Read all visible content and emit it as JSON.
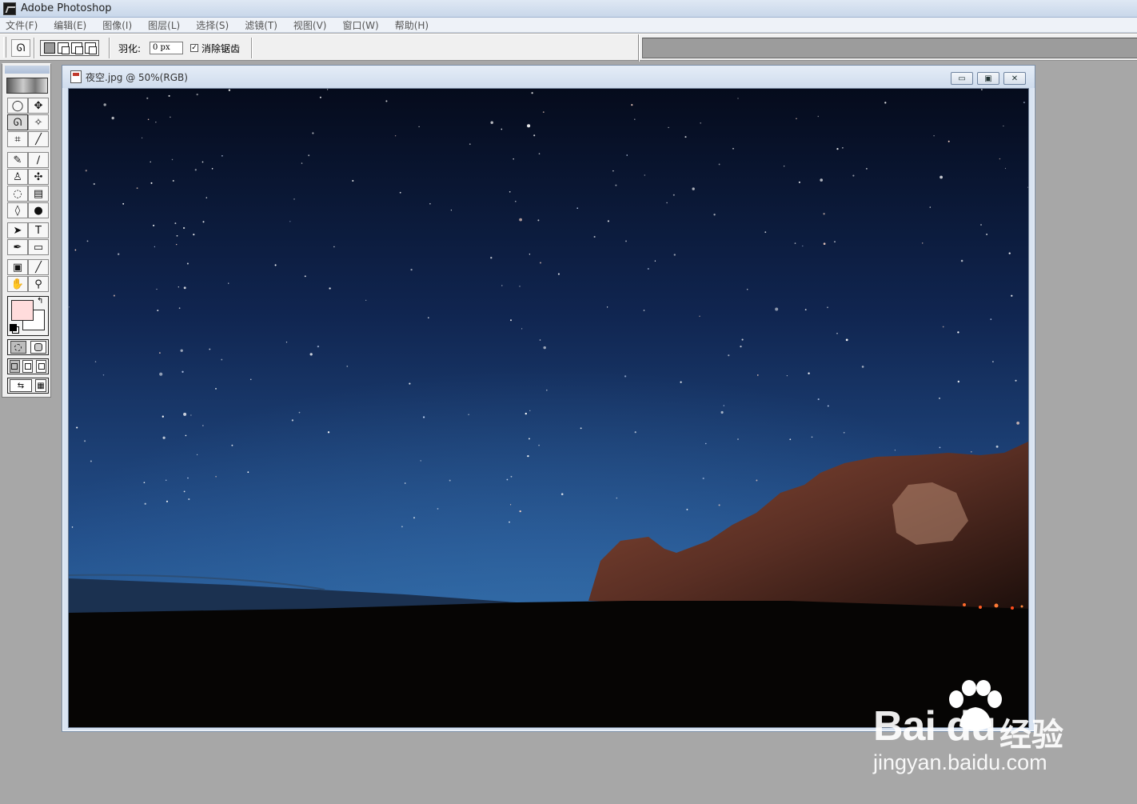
{
  "app": {
    "title": "Adobe Photoshop"
  },
  "menu": {
    "items": [
      "文件(F)",
      "编辑(E)",
      "图像(I)",
      "图层(L)",
      "选择(S)",
      "滤镜(T)",
      "视图(V)",
      "窗口(W)",
      "帮助(H)"
    ]
  },
  "options": {
    "tool_icon": "lasso-icon",
    "feather_label": "羽化:",
    "feather_value": "0 px",
    "antialias_checked": "✓",
    "antialias_label": "消除锯齿"
  },
  "toolbox": {
    "foreground_color": "#ffdcdc",
    "background_color": "#ffffff",
    "tools": [
      [
        "marquee-icon",
        "move-icon"
      ],
      [
        "lasso-icon",
        "magic-wand-icon"
      ],
      [
        "crop-icon",
        "slice-icon"
      ],
      [
        "healing-brush-icon",
        "brush-icon"
      ],
      [
        "clone-stamp-icon",
        "history-brush-icon"
      ],
      [
        "eraser-icon",
        "gradient-icon"
      ],
      [
        "blur-icon",
        "dodge-icon"
      ],
      [
        "path-selection-icon",
        "type-icon"
      ],
      [
        "pen-icon",
        "rectangle-icon"
      ],
      [
        "notes-icon",
        "eyedropper-icon"
      ],
      [
        "hand-icon",
        "zoom-icon"
      ]
    ],
    "tool_glyphs": [
      "◯",
      "✥",
      "ᘏ",
      "✧",
      "⌗",
      "╱",
      "✎",
      "∕",
      "♙",
      "✣",
      "◌",
      "▤",
      "◊",
      "●",
      "➤",
      "T",
      "✒",
      "▭",
      "▣",
      "╱",
      "✋",
      "⚲"
    ]
  },
  "document": {
    "title": "夜空.jpg @ 50%(RGB)",
    "min_glyph": "▭",
    "max_glyph": "▣",
    "close_glyph": "✕",
    "palette": {
      "sky_top": "#050b1c",
      "sky_mid": "#17305e",
      "sky_horizon": "#2f6aa6",
      "ground": "#060504",
      "rock": "#7a4030"
    }
  },
  "watermark": {
    "brand": "Bai du",
    "cn": "经验",
    "sub": "jingyan.baidu.com"
  }
}
